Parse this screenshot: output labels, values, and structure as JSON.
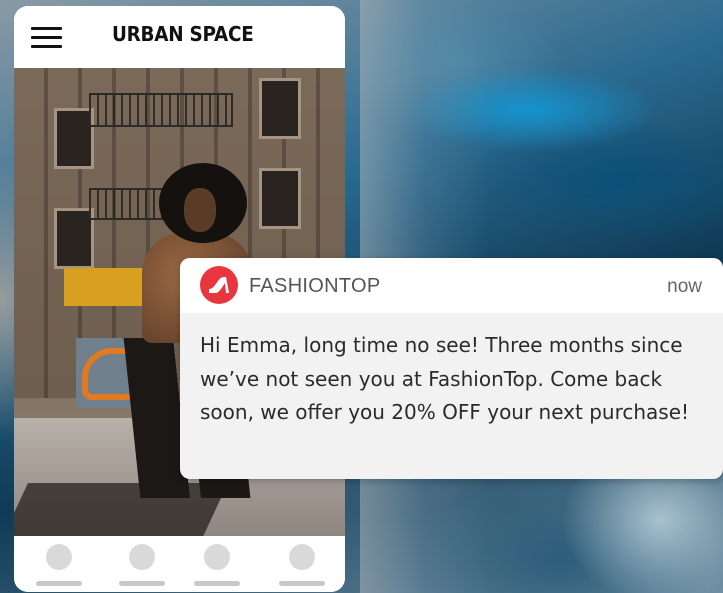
{
  "app": {
    "brand": "URBAN SPACE"
  },
  "header": {
    "menu_icon": "hamburger-menu-icon"
  },
  "hero": {
    "image": "woman-in-leopard-print-top-on-city-street"
  },
  "bottom_nav": {
    "items": [
      {
        "icon": "nav-circle-icon"
      },
      {
        "icon": "nav-circle-icon"
      },
      {
        "icon": "nav-circle-icon"
      },
      {
        "icon": "nav-circle-icon"
      }
    ]
  },
  "notification": {
    "app_name": "FASHIONTOP",
    "time": "now",
    "icon": "high-heel-shoe-icon",
    "icon_color": "#e8363f",
    "message": "Hi Emma, long time no see! Three months since we’ve not seen you at FashionTop. Come back soon, we offer you 20% OFF your next purchase!"
  },
  "colors": {
    "notification_background": "#f2f2f2",
    "phone_background": "#ffffff",
    "nav_placeholder": "#d9d9d9"
  }
}
